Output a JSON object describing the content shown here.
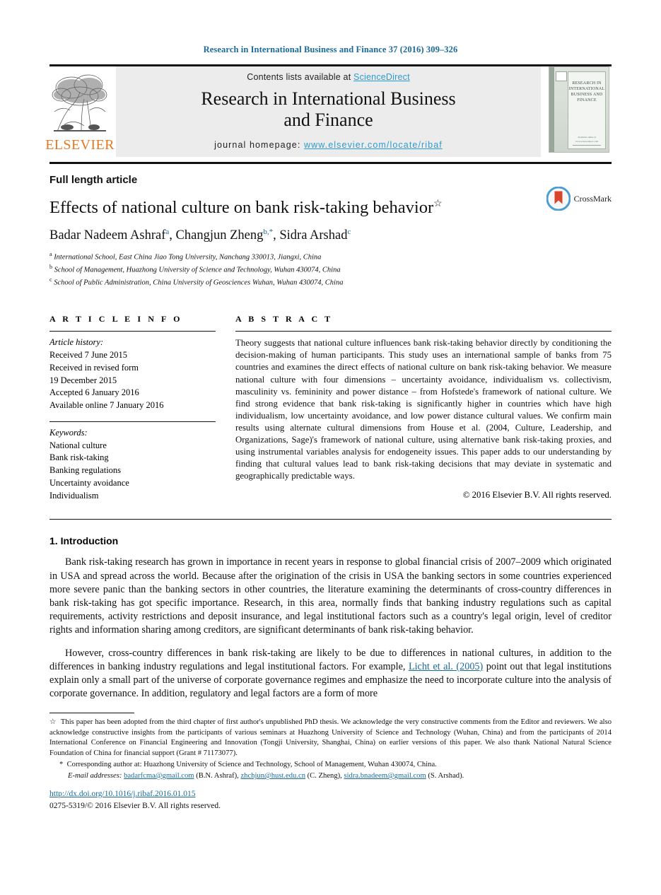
{
  "running_head": "Research in International Business and Finance 37 (2016) 309–326",
  "masthead": {
    "publisher_name": "ELSEVIER",
    "contents_prefix": "Contents lists available at ",
    "contents_link": "ScienceDirect",
    "journal_title_line1": "Research in International Business",
    "journal_title_line2": "and Finance",
    "homepage_prefix": "journal homepage: ",
    "homepage_url": "www.elsevier.com/locate/ribaf",
    "cover_title": "RESEARCH IN INTERNATIONAL BUSINESS AND FINANCE",
    "cover_footer": "Available online at www.sciencedirect.com",
    "cover_brand": "ScienceDirect"
  },
  "article": {
    "type": "Full length article",
    "title": "Effects of national culture on bank risk-taking behavior",
    "title_marker": "☆",
    "authors_plain": "Badar Nadeem Ashraf, Changjun Zheng, Sidra Arshad",
    "authors": [
      {
        "name": "Badar Nadeem Ashraf",
        "sup": "a"
      },
      {
        "name": "Changjun Zheng",
        "sup": "b,*"
      },
      {
        "name": "Sidra Arshad",
        "sup": "c"
      }
    ],
    "affiliations": [
      {
        "label": "a",
        "text": "International School, East China Jiao Tong University, Nanchang 330013, Jiangxi, China"
      },
      {
        "label": "b",
        "text": "School of Management, Huazhong University of Science and Technology, Wuhan 430074, China"
      },
      {
        "label": "c",
        "text": "School of Public Administration, China University of Geosciences Wuhan, Wuhan 430074, China"
      }
    ],
    "crossmark_label": "CrossMark"
  },
  "article_info": {
    "heading": "A R T I C L E   I N F O",
    "history_label": "Article history:",
    "history": [
      "Received 7 June 2015",
      "Received in revised form",
      "19 December 2015",
      "Accepted 6 January 2016",
      "Available online 7 January 2016"
    ],
    "keywords_label": "Keywords:",
    "keywords": [
      "National culture",
      "Bank risk-taking",
      "Banking regulations",
      "Uncertainty avoidance",
      "Individualism"
    ]
  },
  "abstract": {
    "heading": "A B S T R A C T",
    "text": "Theory suggests that national culture influences bank risk-taking behavior directly by conditioning the decision-making of human participants. This study uses an international sample of banks from 75 countries and examines the direct effects of national culture on bank risk-taking behavior. We measure national culture with four dimensions – uncertainty avoidance, individualism vs. collectivism, masculinity vs. femininity and power distance – from Hofstede's framework of national culture. We find strong evidence that bank risk-taking is significantly higher in countries which have high individualism, low uncertainty avoidance, and low power distance cultural values. We confirm main results using alternate cultural dimensions from House et al. (2004, Culture, Leadership, and Organizations, Sage)'s framework of national culture, using alternative bank risk-taking proxies, and using instrumental variables analysis for endogeneity issues. This paper adds to our understanding by finding that cultural values lead to bank risk-taking decisions that may deviate in systematic and geographically predictable ways.",
    "copyright": "© 2016 Elsevier B.V. All rights reserved."
  },
  "body": {
    "section_number_title": "1. Introduction",
    "paragraph1_a": "Bank risk-taking research has grown in importance in recent years in response to global financial crisis of 2007–2009 which originated in USA and spread across the world. Because after the origination of the crisis in USA the banking sectors in some countries experienced more severe panic than the banking sectors in other countries, the literature examining the determinants of cross-country differences in bank risk-taking has got specific importance. Research, in this area, normally finds that banking industry regulations such as capital requirements, activity restrictions and deposit insurance, and legal institutional factors such as a country's legal origin, level of creditor rights and information sharing among creditors, are significant determinants of bank risk-taking behavior.",
    "paragraph2_a": "However, cross-country differences in bank risk-taking are likely to be due to differences in national cultures, in addition to the differences in banking industry regulations and legal institutional factors. For example, ",
    "paragraph2_link": "Licht et al. (2005)",
    "paragraph2_b": " point out that legal institutions explain only a small part of the universe of corporate governance regimes and emphasize the need to incorporate culture into the analysis of corporate governance. In addition, regulatory and legal factors are a form of more"
  },
  "footnotes": {
    "star_mark": "☆",
    "star_text": "This paper has been adopted from the third chapter of first author's unpublished PhD thesis. We acknowledge the very constructive comments from the Editor and reviewers. We also acknowledge constructive insights from the participants of various seminars at Huazhong University of Science and Technology (Wuhan, China) and from the participants of 2014 International Conference on Financial Engineering and Innovation (Tongji University, Shanghai, China) on earlier versions of this paper. We also thank National Natural Science Foundation of China for financial support (Grant # 71173077).",
    "asterisk_mark": "*",
    "corresponding_text": "Corresponding author at: Huazhong University of Science and Technology, School of Management, Wuhan 430074, China.",
    "emails_label": "E-mail addresses:",
    "emails": [
      {
        "address": "badarfcma@gmail.com",
        "owner": "(B.N. Ashraf),"
      },
      {
        "address": "zhchjun@hust.edu.cn",
        "owner": "(C. Zheng),"
      },
      {
        "address": "sidra.bnadeem@gmail.com",
        "owner": "(S. Arshad)."
      }
    ]
  },
  "footer": {
    "doi": "http://dx.doi.org/10.1016/j.ribaf.2016.01.015",
    "issn": "0275-5319/© 2016 Elsevier B.V. All rights reserved."
  },
  "colors": {
    "link": "#1a6a9b",
    "science_direct": "#2e9bd0",
    "elsevier_orange": "#E87722",
    "banner_bg": "#ececec"
  }
}
